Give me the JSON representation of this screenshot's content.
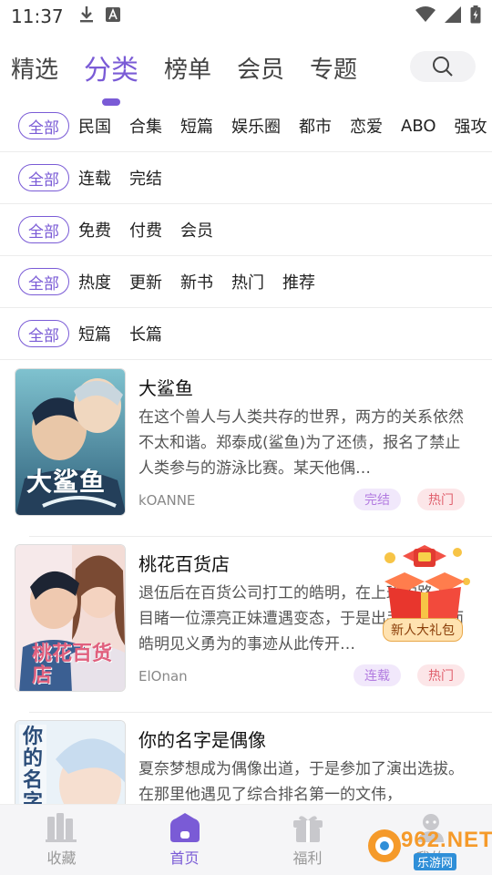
{
  "status_bar": {
    "time": "11:37"
  },
  "top_tabs": [
    {
      "label": "精选"
    },
    {
      "label": "分类",
      "active": true
    },
    {
      "label": "榜单"
    },
    {
      "label": "会员"
    },
    {
      "label": "专题"
    }
  ],
  "filters": [
    {
      "all": "全部",
      "options": [
        "民国",
        "合集",
        "短篇",
        "娱乐圈",
        "都市",
        "恋爱",
        "ABO",
        "强攻"
      ]
    },
    {
      "all": "全部",
      "options": [
        "连载",
        "完结"
      ]
    },
    {
      "all": "全部",
      "options": [
        "免费",
        "付费",
        "会员"
      ]
    },
    {
      "all": "全部",
      "options": [
        "热度",
        "更新",
        "新书",
        "热门",
        "推荐"
      ]
    },
    {
      "all": "全部",
      "options": [
        "短篇",
        "长篇"
      ]
    }
  ],
  "books": [
    {
      "title": "大鲨鱼",
      "desc": "在这个兽人与人类共存的世界，两方的关系依然不太和谐。郑泰成(鲨鱼)为了还债，报名了禁止人类参与的游泳比赛。某天他偶…",
      "author": "kOANNE",
      "status": "完结",
      "hot": "热门",
      "cover_text": "大鲨鱼"
    },
    {
      "title": "桃花百货店",
      "desc": "退伍后在百货公司打工的皓明，在上班的路上，目睹一位漂亮正妹遭遇变态，于是出手相救。而皓明见义勇为的事迹从此传开…",
      "author": "ElOnan",
      "status": "连载",
      "hot": "热门",
      "cover_text": "桃花百货店"
    },
    {
      "title": "你的名字是偶像",
      "desc": "夏奈梦想成为偶像出道，于是参加了演出选拔。在那里他遇见了综合排名第一的文伟，",
      "author": "",
      "status": "",
      "hot": "",
      "cover_text": "你的名字是偶"
    }
  ],
  "gift": {
    "label": "新人大礼包"
  },
  "bottom_nav": [
    {
      "label": "收藏"
    },
    {
      "label": "首页",
      "active": true
    },
    {
      "label": "福利"
    },
    {
      "label": "我的"
    }
  ],
  "watermark": {
    "brand": "962.NET",
    "sub": "乐游网"
  },
  "colors": {
    "accent": "#7a5bd6",
    "hot": "#e0606d",
    "status": "#b27be0"
  }
}
